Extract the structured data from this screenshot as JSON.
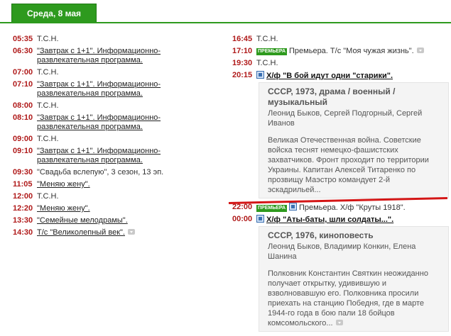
{
  "header": {
    "date_tab": "Среда, 8 мая"
  },
  "left_schedule": [
    {
      "time": "05:35",
      "title": "Т.С.Н.",
      "link": false
    },
    {
      "time": "06:30",
      "title": "\"Завтрак с 1+1\". Информационно-развлекательная программа.",
      "link": true
    },
    {
      "time": "07:00",
      "title": "Т.С.Н.",
      "link": false
    },
    {
      "time": "07:10",
      "title": "\"Завтрак с 1+1\". Информационно-развлекательная программа.",
      "link": true
    },
    {
      "time": "08:00",
      "title": "Т.С.Н.",
      "link": false
    },
    {
      "time": "08:10",
      "title": "\"Завтрак с 1+1\". Информационно-развлекательная программа.",
      "link": true
    },
    {
      "time": "09:00",
      "title": "Т.С.Н.",
      "link": false
    },
    {
      "time": "09:10",
      "title": "\"Завтрак с 1+1\". Информационно-развлекательная программа.",
      "link": true
    },
    {
      "time": "09:30",
      "title": "\"Свадьба вслепую\", 3 сезон, 13 эп.",
      "link": false
    },
    {
      "time": "11:05",
      "title": "\"Меняю жену\".",
      "link": true
    },
    {
      "time": "12:00",
      "title": "Т.С.Н.",
      "link": false
    },
    {
      "time": "12:20",
      "title": "\"Меняю жену\".",
      "link": true
    },
    {
      "time": "13:30",
      "title": "\"Семейные мелодрамы\".",
      "link": true
    },
    {
      "time": "14:30",
      "title": "Т/с \"Великолепный век\".",
      "link": true
    }
  ],
  "right_schedule": {
    "r1": {
      "time": "16:45",
      "title": "Т.С.Н."
    },
    "r2": {
      "time": "17:10",
      "badge": "ПРЕМЬЕРА",
      "title": "Премьера. Т/с \"Моя чужая жизнь\"."
    },
    "r3": {
      "time": "19:30",
      "title": "Т.С.Н."
    },
    "r4": {
      "time": "20:15",
      "title": "Х/ф \"В бой идут одни \"старики\".",
      "meta": "СССР, 1973, драма / военный / музыкальный",
      "cast": "Леонид Быков, Сергей Подгорный, Сергей Иванов",
      "desc": "Великая Отечественная война. Советские войска теснят немецко-фашистских захватчиков. Фронт проходит по территории Украины. Капитан Алексей Титаренко по прозвищу Маэстро командует 2-й эскадрильей..."
    },
    "r5": {
      "time": "22:00",
      "badge": "ПРЕМЬЕРА",
      "title": "Премьера. Х/ф \"Круты 1918\"."
    },
    "r6": {
      "time": "00:00",
      "title": "Х/ф \"Аты-баты, шли солдаты...\".",
      "meta": "СССР, 1976, киноповесть",
      "cast": "Леонид Быков, Владимир Конкин, Елена Шанина",
      "desc": "Полковник Константин Святкин неожиданно получает открытку, удивившую и взволновавшую его. Полковника просили приехать на станцию Победня, где в марте 1944-го года в бою пали 18 бойцов комсомольского..."
    }
  },
  "colors": {
    "accent": "#2e9a1e",
    "time": "#b01a1a",
    "highlight_line": "#d41616"
  }
}
